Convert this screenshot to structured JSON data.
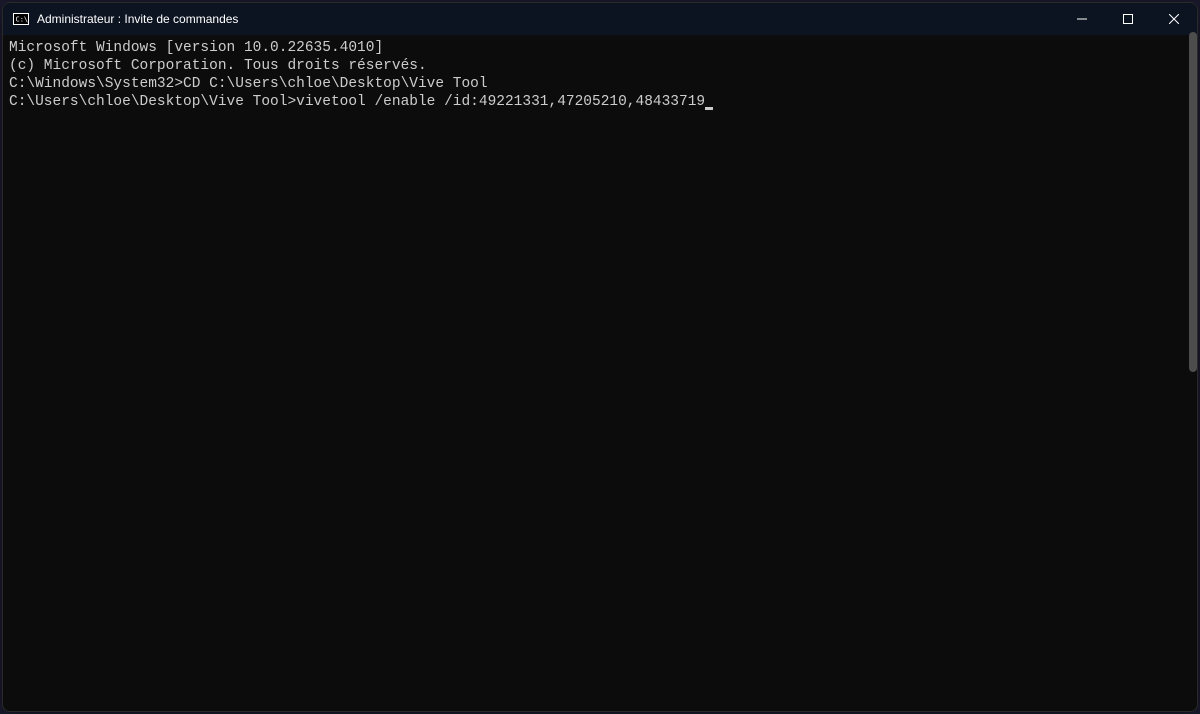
{
  "window": {
    "title": "Administrateur : Invite de commandes"
  },
  "terminal": {
    "lines": [
      "Microsoft Windows [version 10.0.22635.4010]",
      "(c) Microsoft Corporation. Tous droits réservés.",
      "",
      "C:\\Windows\\System32>CD C:\\Users\\chloe\\Desktop\\Vive Tool",
      "",
      "C:\\Users\\chloe\\Desktop\\Vive Tool>vivetool /enable /id:49221331,47205210,48433719"
    ]
  }
}
